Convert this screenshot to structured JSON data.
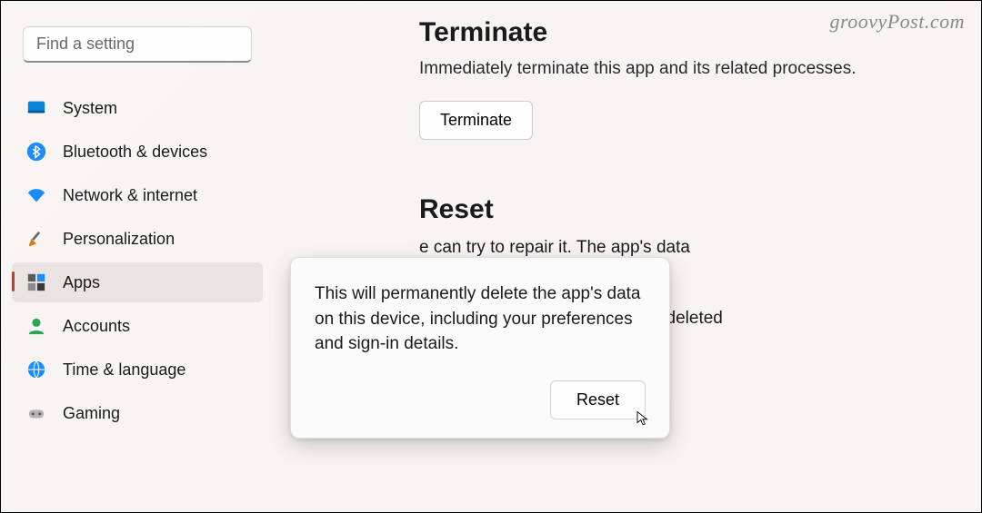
{
  "watermark": "groovyPost.com",
  "search": {
    "placeholder": "Find a setting"
  },
  "sidebar": {
    "items": [
      {
        "label": "System"
      },
      {
        "label": "Bluetooth & devices"
      },
      {
        "label": "Network & internet"
      },
      {
        "label": "Personalization"
      },
      {
        "label": "Apps"
      },
      {
        "label": "Accounts"
      },
      {
        "label": "Time & language"
      },
      {
        "label": "Gaming"
      }
    ]
  },
  "main": {
    "terminate": {
      "title": "Terminate",
      "desc": "Immediately terminate this app and its related processes.",
      "button": "Terminate"
    },
    "reset": {
      "title": "Reset",
      "line1": "e can try to repair it. The app's data",
      "line2": "t, reset it. The app's data will be deleted",
      "button": "Reset"
    }
  },
  "tooltip": {
    "text": "This will permanently delete the app's data on this device, including your preferences and sign-in details.",
    "button": "Reset"
  }
}
